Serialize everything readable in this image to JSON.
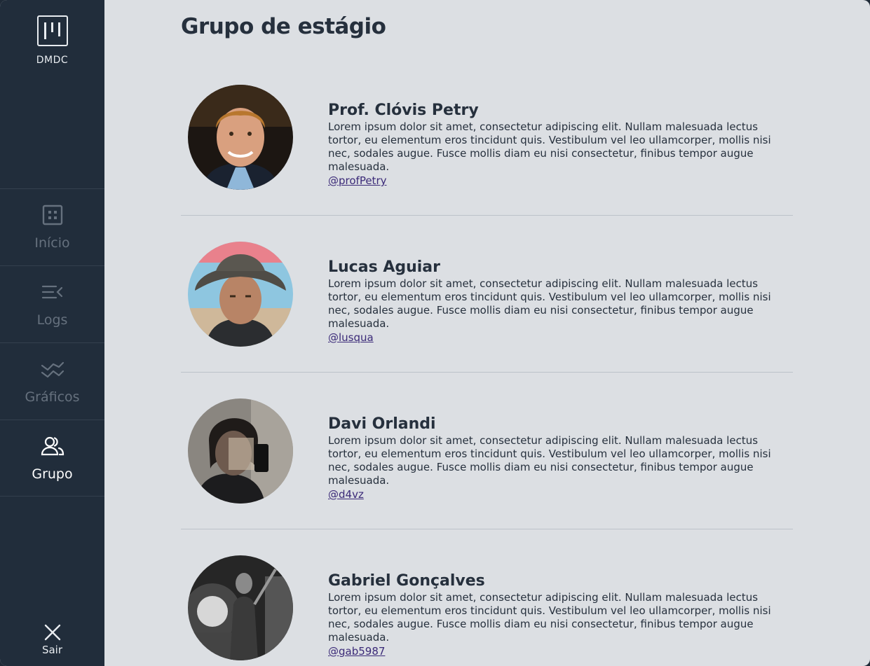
{
  "brand": {
    "name": "DMDC",
    "logo_icon": "kanban-board-icon"
  },
  "nav": {
    "items": [
      {
        "label": "Início",
        "icon": "grid-icon",
        "active": false
      },
      {
        "label": "Logs",
        "icon": "list-collapse-icon",
        "active": false
      },
      {
        "label": "Gráficos",
        "icon": "trend-lines-icon",
        "active": false
      },
      {
        "label": "Grupo",
        "icon": "users-icon",
        "active": true
      }
    ],
    "logout": {
      "label": "Sair",
      "icon": "close-icon"
    }
  },
  "page": {
    "title": "Grupo de estágio"
  },
  "members": [
    {
      "name": "Prof. Clóvis Petry",
      "bio": "Lorem ipsum dolor sit amet, consectetur adipiscing elit. Nullam malesuada lectus tortor, eu elementum eros tincidunt quis. Vestibulum vel leo ullamcorper, mollis nisi nec, sodales augue. Fusce mollis diam eu nisi consectetur, finibus tempor augue malesuada.",
      "handle": "@profPetry"
    },
    {
      "name": "Lucas Aguiar",
      "bio": "Lorem ipsum dolor sit amet, consectetur adipiscing elit. Nullam malesuada lectus tortor, eu elementum eros tincidunt quis. Vestibulum vel leo ullamcorper, mollis nisi nec, sodales augue. Fusce mollis diam eu nisi consectetur, finibus tempor augue malesuada.",
      "handle": "@lusqua"
    },
    {
      "name": "Davi Orlandi",
      "bio": "Lorem ipsum dolor sit amet, consectetur adipiscing elit. Nullam malesuada lectus tortor, eu elementum eros tincidunt quis. Vestibulum vel leo ullamcorper, mollis nisi nec, sodales augue. Fusce mollis diam eu nisi consectetur, finibus tempor augue malesuada.",
      "handle": "@d4vz"
    },
    {
      "name": "Gabriel Gonçalves",
      "bio": "Lorem ipsum dolor sit amet, consectetur adipiscing elit. Nullam malesuada lectus tortor, eu elementum eros tincidunt quis. Vestibulum vel leo ullamcorper, mollis nisi nec, sodales augue. Fusce mollis diam eu nisi consectetur, finibus tempor augue malesuada.",
      "handle": "@gab5987"
    }
  ],
  "colors": {
    "sidebar_bg": "#212d3b",
    "main_bg": "#dcdfe3",
    "text": "#26303d",
    "link": "#3b2a78"
  }
}
